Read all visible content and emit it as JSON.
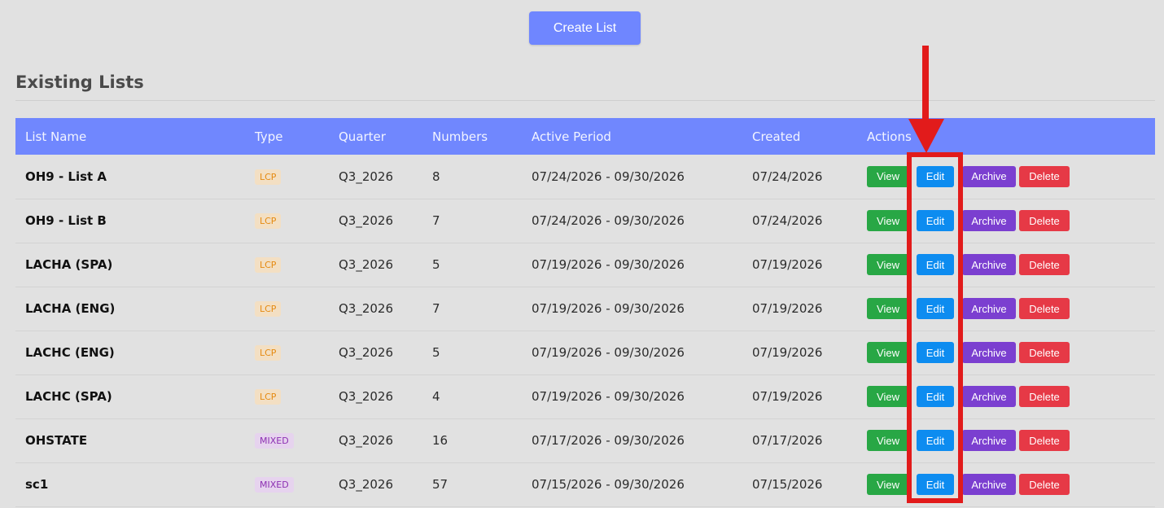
{
  "toolbar": {
    "create_label": "Create List"
  },
  "section": {
    "title": "Existing Lists"
  },
  "table": {
    "headers": [
      "List Name",
      "Type",
      "Quarter",
      "Numbers",
      "Active Period",
      "Created",
      "Actions"
    ],
    "action_labels": {
      "view": "View",
      "edit": "Edit",
      "archive": "Archive",
      "delete": "Delete"
    },
    "rows": [
      {
        "name": "OH9 - List A",
        "type": "LCP",
        "quarter": "Q3_2026",
        "numbers": "8",
        "period": "07/24/2026 - 09/30/2026",
        "created": "07/24/2026"
      },
      {
        "name": "OH9 - List B",
        "type": "LCP",
        "quarter": "Q3_2026",
        "numbers": "7",
        "period": "07/24/2026 - 09/30/2026",
        "created": "07/24/2026"
      },
      {
        "name": "LACHA (SPA)",
        "type": "LCP",
        "quarter": "Q3_2026",
        "numbers": "5",
        "period": "07/19/2026 - 09/30/2026",
        "created": "07/19/2026"
      },
      {
        "name": "LACHA (ENG)",
        "type": "LCP",
        "quarter": "Q3_2026",
        "numbers": "7",
        "period": "07/19/2026 - 09/30/2026",
        "created": "07/19/2026"
      },
      {
        "name": "LACHC (ENG)",
        "type": "LCP",
        "quarter": "Q3_2026",
        "numbers": "5",
        "period": "07/19/2026 - 09/30/2026",
        "created": "07/19/2026"
      },
      {
        "name": "LACHC (SPA)",
        "type": "LCP",
        "quarter": "Q3_2026",
        "numbers": "4",
        "period": "07/19/2026 - 09/30/2026",
        "created": "07/19/2026"
      },
      {
        "name": "OHSTATE",
        "type": "MIXED",
        "quarter": "Q3_2026",
        "numbers": "16",
        "period": "07/17/2026 - 09/30/2026",
        "created": "07/17/2026"
      },
      {
        "name": "sc1",
        "type": "MIXED",
        "quarter": "Q3_2026",
        "numbers": "57",
        "period": "07/15/2026 - 09/30/2026",
        "created": "07/15/2026"
      }
    ]
  },
  "colors": {
    "accent": "#7087fe",
    "view": "#28a745",
    "edit": "#0d8cf0",
    "archive": "#7b3fd0",
    "delete": "#e63946",
    "annotation": "#e21b1b"
  }
}
